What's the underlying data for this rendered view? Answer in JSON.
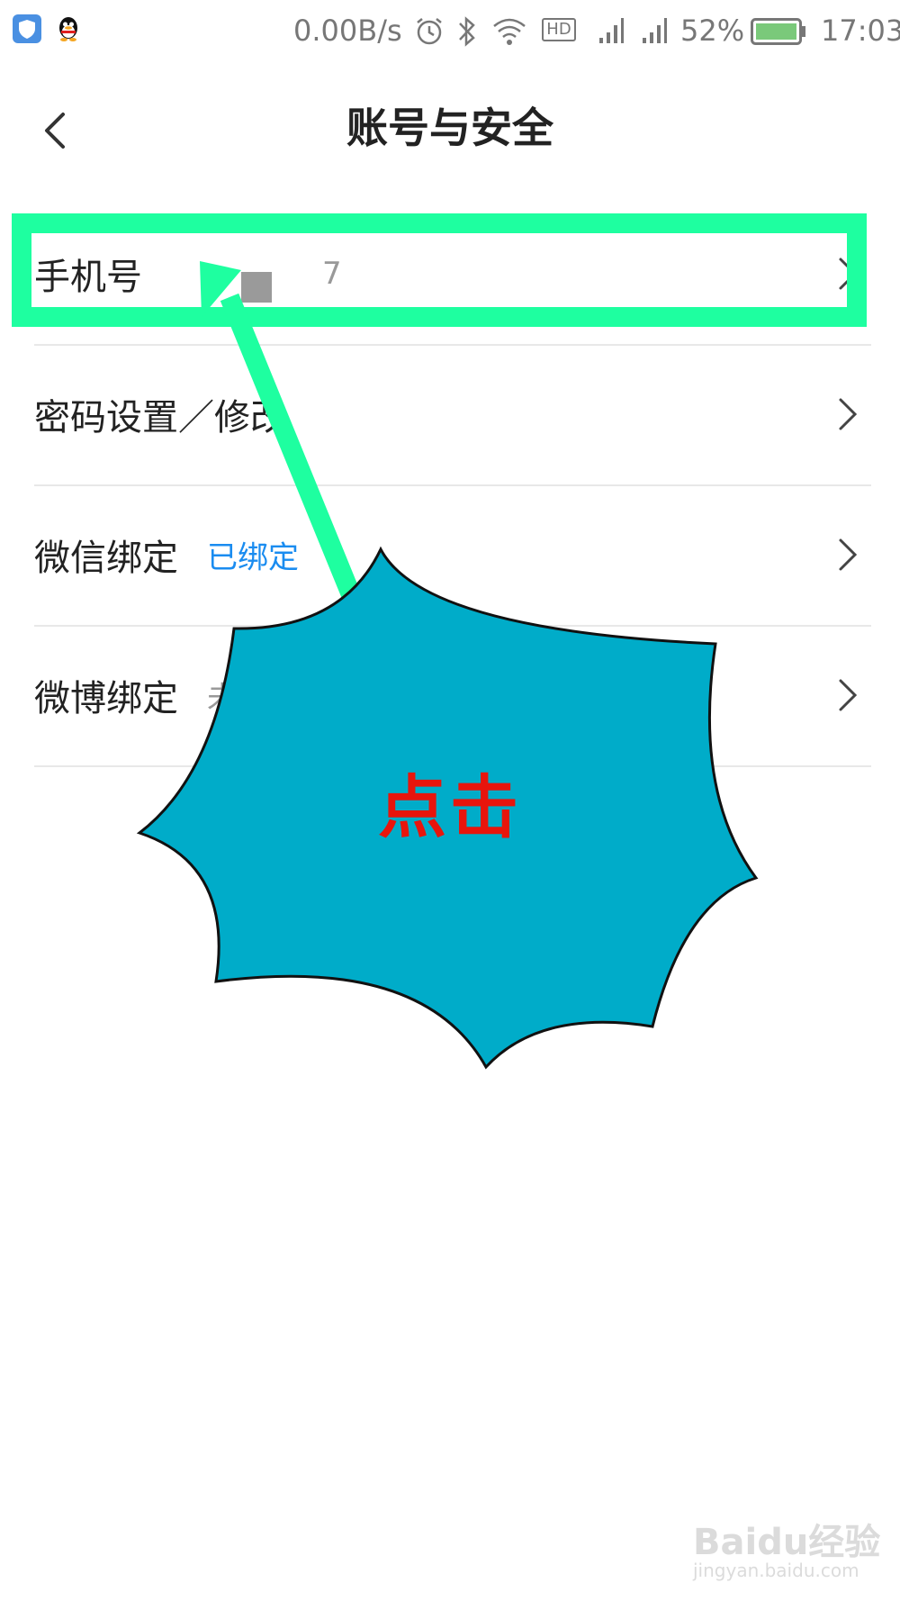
{
  "status_bar": {
    "icons_left": [
      "shield-icon",
      "qq-penguin-icon"
    ],
    "network_speed": "0.00B/s",
    "hd_badge": "HD",
    "battery_percent": "52%",
    "time": "17:03",
    "battery_level": 0.52
  },
  "header": {
    "back_icon": "chevron-left-icon",
    "title": "账号与安全"
  },
  "rows": [
    {
      "label": "手机号",
      "value": "7",
      "value_color": "#999999"
    },
    {
      "label": "密码设置／修改",
      "value": ""
    },
    {
      "label": "微信绑定",
      "value": "已绑定",
      "value_color": "#1a8cf0"
    },
    {
      "label": "微博绑定",
      "value": "未",
      "value_color": "#999999"
    }
  ],
  "annotation": {
    "callout_text": "点击",
    "highlight_color": "#1effa0",
    "burst_color": "#00acc9",
    "text_color": "#e8150c"
  },
  "watermark": {
    "main": "Baidu经验",
    "sub": "jingyan.baidu.com"
  }
}
